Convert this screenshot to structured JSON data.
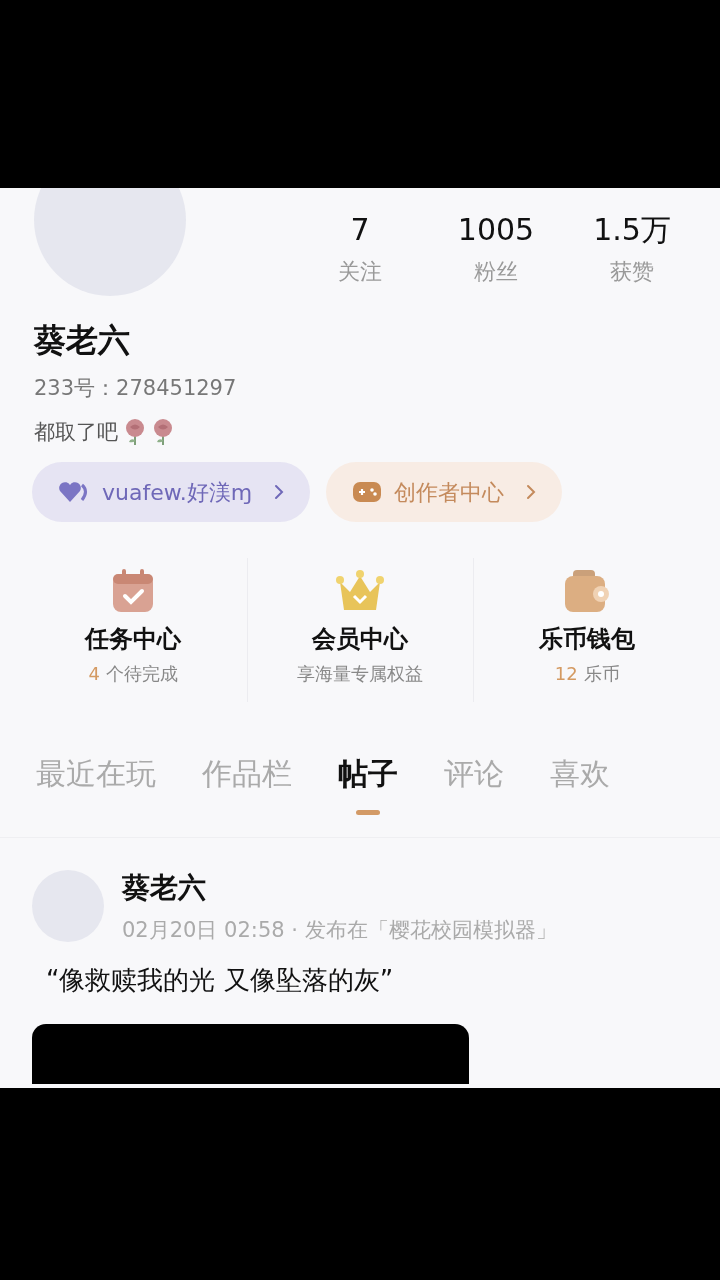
{
  "profile": {
    "name": "葵老六",
    "id_line": "233号：278451297",
    "bio": "都取了吧",
    "stats": [
      {
        "value": "7",
        "label": "关注"
      },
      {
        "value": "1005",
        "label": "粉丝"
      },
      {
        "value": "1.5万",
        "label": "获赞"
      }
    ],
    "badges": [
      {
        "kind": "fan",
        "label": "vuafew.好渼ɱ"
      },
      {
        "kind": "creator",
        "label": "创作者中心"
      }
    ]
  },
  "services": [
    {
      "kind": "task",
      "title": "任务中心",
      "count": "4",
      "note": "个待完成"
    },
    {
      "kind": "vip",
      "title": "会员中心",
      "note": "享海量专属权益"
    },
    {
      "kind": "wallet",
      "title": "乐币钱包",
      "count": "12",
      "note": "乐币"
    }
  ],
  "tabs": [
    {
      "label": "最近在玩",
      "selected": false
    },
    {
      "label": "作品栏",
      "selected": false
    },
    {
      "label": "帖子",
      "selected": true
    },
    {
      "label": "评论",
      "selected": false
    },
    {
      "label": "喜欢",
      "selected": false
    }
  ],
  "post": {
    "author": "葵老六",
    "meta": "02月20日 02:58 · 发布在「樱花校园模拟器」",
    "text": "“像救赎我的光 又像坠落的灰”"
  }
}
